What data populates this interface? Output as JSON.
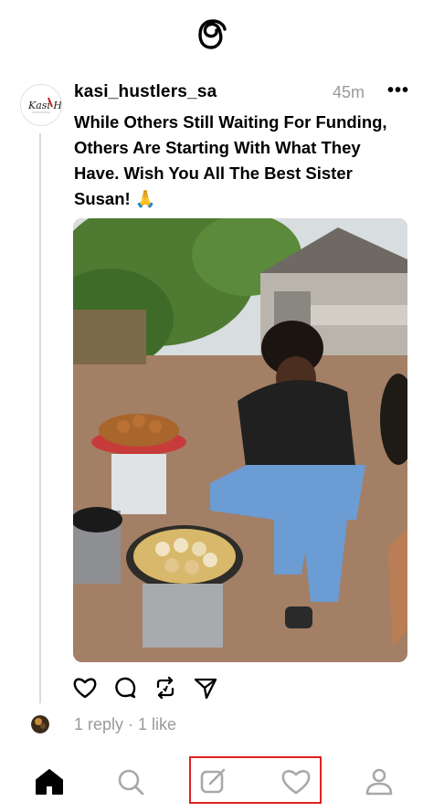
{
  "post": {
    "username": "kasi_hustlers_sa",
    "time": "45m",
    "more_label": "•••",
    "text": "While Others Still Waiting For Funding, Others Are Starting With What They Have. Wish You All The Best Sister Susan! 🙏",
    "avatar_text": "Kasi H"
  },
  "stats": {
    "summary": "1 reply · 1 like"
  },
  "actions": [
    "heart-icon",
    "comment-icon",
    "repost-icon",
    "share-icon"
  ],
  "nav": [
    "home-icon",
    "search-icon",
    "compose-icon",
    "activity-heart-icon",
    "profile-icon"
  ],
  "colors": {
    "highlight": "#e02020",
    "muted": "#9a9a9a"
  }
}
